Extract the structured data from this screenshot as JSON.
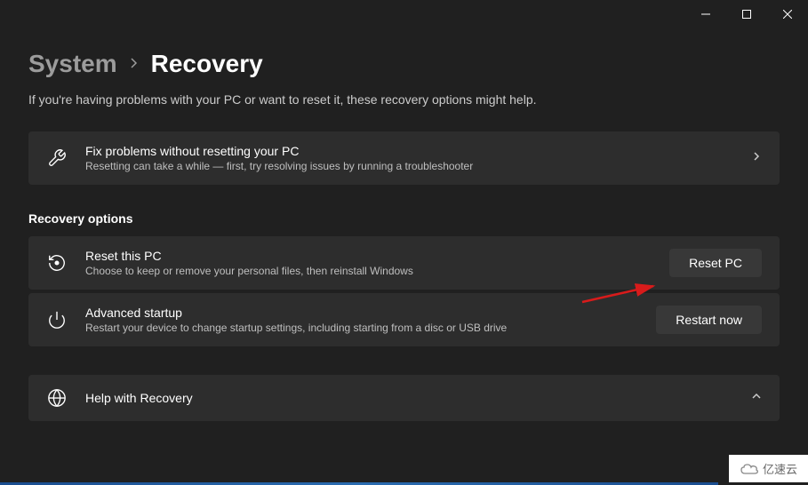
{
  "breadcrumb": {
    "parent": "System",
    "current": "Recovery"
  },
  "subtitle": "If you're having problems with your PC or want to reset it, these recovery options might help.",
  "fixProblems": {
    "title": "Fix problems without resetting your PC",
    "desc": "Resetting can take a while — first, try resolving issues by running a troubleshooter"
  },
  "sectionHeader": "Recovery options",
  "resetPc": {
    "title": "Reset this PC",
    "desc": "Choose to keep or remove your personal files, then reinstall Windows",
    "button": "Reset PC"
  },
  "advancedStartup": {
    "title": "Advanced startup",
    "desc": "Restart your device to change startup settings, including starting from a disc or USB drive",
    "button": "Restart now"
  },
  "help": {
    "title": "Help with Recovery"
  },
  "watermark": "亿速云"
}
